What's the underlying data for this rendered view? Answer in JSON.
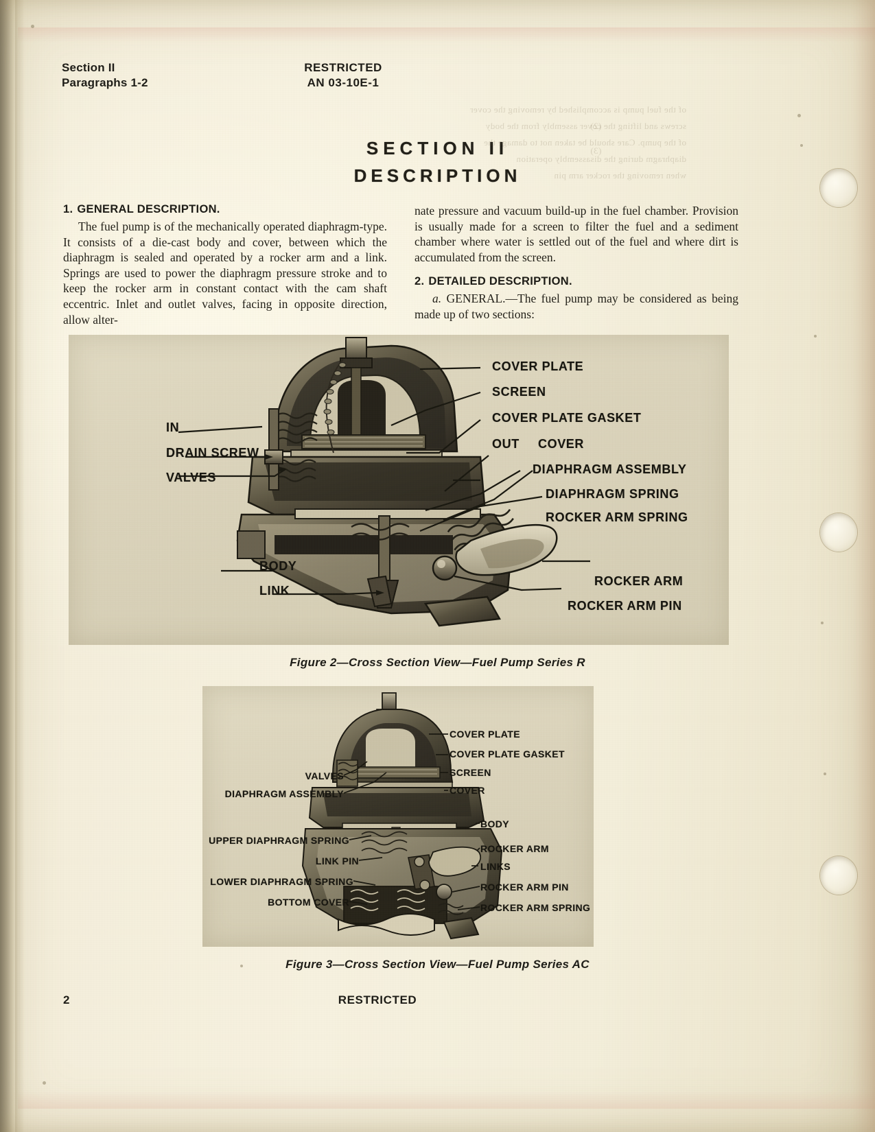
{
  "document": {
    "running_head_left_line1": "Section II",
    "running_head_left_line2": "Paragraphs 1-2",
    "running_head_center_line1": "RESTRICTED",
    "running_head_center_line2": "AN 03-10E-1",
    "section_title_line1": "SECTION II",
    "section_title_line2": "DESCRIPTION",
    "page_number": "2",
    "footer_classification": "RESTRICTED",
    "paper_color": "#f3eedb",
    "ink_color": "#211f18"
  },
  "columns": {
    "left": {
      "heading_number": "1.",
      "heading_text": "GENERAL DESCRIPTION.",
      "paragraph": "The fuel pump is of the mechanically operated diaphragm-type. It consists of a die-cast body and cover, between which the diaphragm is sealed and operated by a rocker arm and a link. Springs are used to power the diaphragm pressure stroke and to keep the rocker arm in constant contact with the cam shaft eccentric. Inlet and outlet valves, facing in opposite direction, allow alter-"
    },
    "right": {
      "paragraph_continued": "nate pressure and vacuum build-up in the fuel chamber. Provision is usually made for a screen to filter the fuel and a sediment chamber where water is settled out of the fuel and where dirt is accumulated from the screen.",
      "heading_number": "2.",
      "heading_text": "DETAILED DESCRIPTION.",
      "subheading_letter": "a.",
      "subheading_body": "GENERAL.—The fuel pump may be considered as being made up of two sections:"
    }
  },
  "figures": [
    {
      "id": "figure-2",
      "caption": "Figure 2—Cross Section View—Fuel Pump Series R",
      "labels_left": [
        "IN",
        "DRAIN SCREW",
        "VALVES",
        "BODY",
        "LINK"
      ],
      "labels_right": [
        "COVER PLATE",
        "SCREEN",
        "COVER PLATE GASKET",
        "OUT",
        "COVER",
        "DIAPHRAGM ASSEMBLY",
        "DIAPHRAGM SPRING",
        "ROCKER ARM SPRING",
        "ROCKER ARM",
        "ROCKER ARM PIN"
      ]
    },
    {
      "id": "figure-3",
      "caption": "Figure 3—Cross Section View—Fuel Pump Series AC",
      "labels_left": [
        "VALVES",
        "DIAPHRAGM ASSEMBLY",
        "UPPER DIAPHRAGM SPRING",
        "LINK PIN",
        "LOWER DIAPHRAGM SPRING",
        "BOTTOM COVER"
      ],
      "labels_right": [
        "COVER PLATE",
        "COVER PLATE GASKET",
        "SCREEN",
        "COVER",
        "BODY",
        "ROCKER ARM",
        "LINKS",
        "ROCKER ARM PIN",
        "ROCKER ARM SPRING"
      ]
    }
  ]
}
